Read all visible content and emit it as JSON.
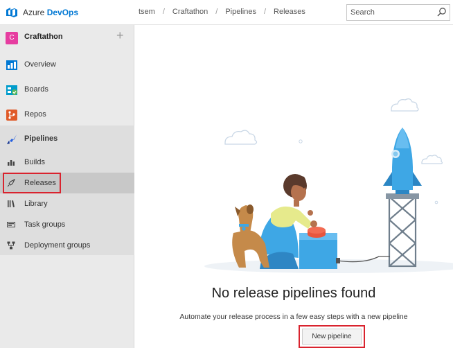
{
  "app": {
    "brand_prefix": "Azure",
    "brand_name": "DevOps"
  },
  "breadcrumb": [
    "tsem",
    "Craftathon",
    "Pipelines",
    "Releases"
  ],
  "search": {
    "placeholder": "Search"
  },
  "project": {
    "initial": "C",
    "name": "Craftathon",
    "color": "#e63da0"
  },
  "nav": {
    "overview": "Overview",
    "boards": "Boards",
    "repos": "Repos",
    "pipelines": "Pipelines"
  },
  "pipelines_sub": {
    "builds": "Builds",
    "releases": "Releases",
    "library": "Library",
    "task_groups": "Task groups",
    "deployment_groups": "Deployment groups"
  },
  "empty_state": {
    "title": "No release pipelines found",
    "subtitle": "Automate your release process in a few easy steps with a new pipeline",
    "button": "New pipeline"
  },
  "colors": {
    "accent": "#0078d4",
    "highlight": "#d9232e"
  }
}
